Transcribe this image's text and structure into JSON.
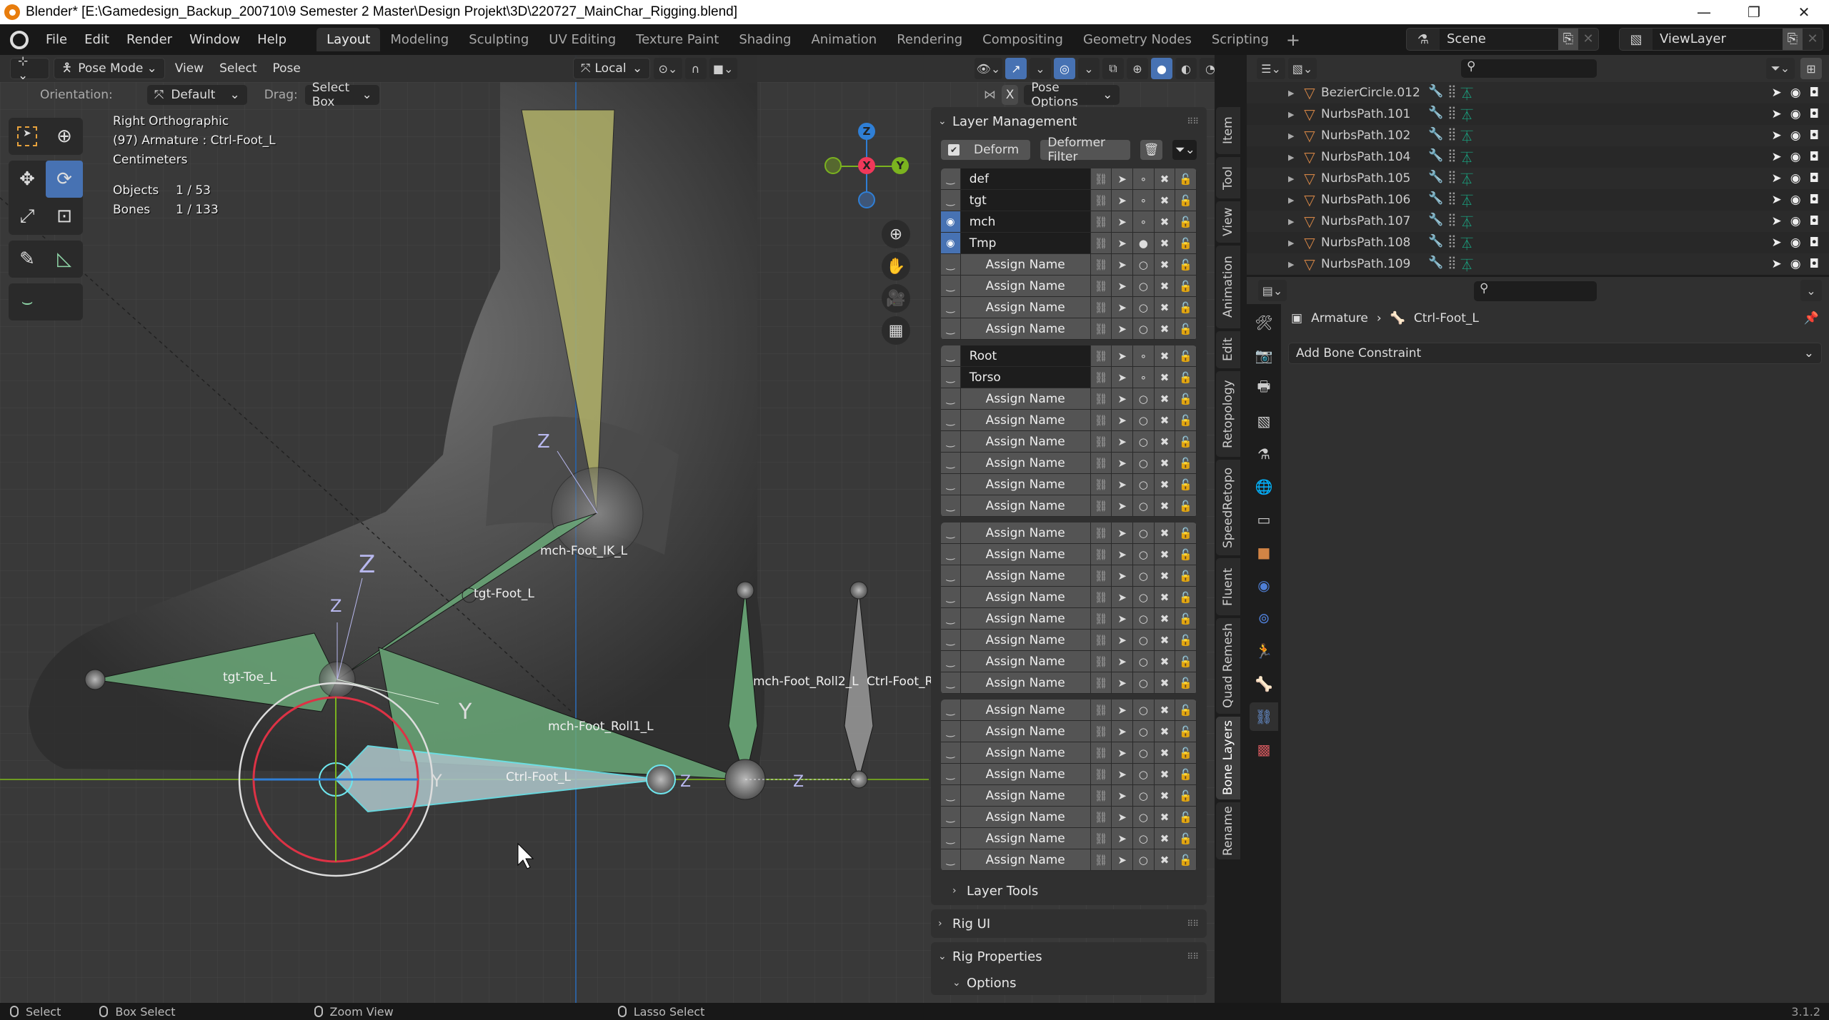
{
  "titlebar": {
    "title": "Blender* [E:\\Gamedesign_Backup_200710\\9 Semester 2 Master\\Design Projekt\\3D\\220727_MainChar_Rigging.blend]",
    "minimize": "—",
    "maximize": "❐",
    "close": "✕"
  },
  "menubar": {
    "menus": [
      "File",
      "Edit",
      "Render",
      "Window",
      "Help"
    ],
    "workspaces": [
      {
        "label": "Layout",
        "active": true
      },
      {
        "label": "Modeling"
      },
      {
        "label": "Sculpting"
      },
      {
        "label": "UV Editing"
      },
      {
        "label": "Texture Paint"
      },
      {
        "label": "Shading"
      },
      {
        "label": "Animation"
      },
      {
        "label": "Rendering"
      },
      {
        "label": "Compositing"
      },
      {
        "label": "Geometry Nodes"
      },
      {
        "label": "Scripting"
      }
    ],
    "add_workspace": "+",
    "scene": "Scene",
    "view_layer": "ViewLayer"
  },
  "viewport_header": {
    "mode": "Pose Mode",
    "menus": [
      "View",
      "Select",
      "Pose"
    ],
    "transform_orientation": "Local"
  },
  "tool_settings": {
    "orientation_label": "Orientation:",
    "orientation_value": "Default",
    "drag_label": "Drag:",
    "drag_value": "Select Box",
    "mirror_x": "X",
    "pose_options": "Pose Options"
  },
  "viewport_info": {
    "view": "Right Orthographic",
    "object": "(97) Armature : Ctrl-Foot_L",
    "units": "Centimeters",
    "objects_label": "Objects",
    "objects_value": "1 / 53",
    "bones_label": "Bones",
    "bones_value": "1 / 133"
  },
  "gizmo": {
    "z": "Z",
    "x": "X",
    "y": "Y"
  },
  "bone_labels": [
    "mch-Foot_IK_L",
    "tgt-Foot_L",
    "tgt-Toe_L",
    "mch-Foot_Roll1_L",
    "mch-Foot_Roll2_L",
    "Ctrl-Foot_Roll",
    "Ctrl-Foot_L"
  ],
  "axis_labels": {
    "z": "Z",
    "y": "Y"
  },
  "layer_management": {
    "title": "Layer Management",
    "deform_label": "Deform",
    "deform_checked": true,
    "deformer_filter": "Deformer Filter",
    "groups": [
      [
        {
          "name": "def",
          "visible": false,
          "named": true,
          "active": false
        },
        {
          "name": "tgt",
          "visible": false,
          "named": true,
          "active": false
        },
        {
          "name": "mch",
          "visible": true,
          "named": true,
          "active": false
        },
        {
          "name": "Tmp",
          "visible": true,
          "named": true,
          "active": true
        },
        {
          "name": "Assign Name",
          "visible": false,
          "named": false
        },
        {
          "name": "Assign Name",
          "visible": false,
          "named": false
        },
        {
          "name": "Assign Name",
          "visible": false,
          "named": false
        },
        {
          "name": "Assign Name",
          "visible": false,
          "named": false
        }
      ],
      [
        {
          "name": "Root",
          "visible": false,
          "named": true,
          "active": false
        },
        {
          "name": "Torso",
          "visible": false,
          "named": true,
          "active": false
        },
        {
          "name": "Assign Name",
          "visible": false,
          "named": false
        },
        {
          "name": "Assign Name",
          "visible": false,
          "named": false
        },
        {
          "name": "Assign Name",
          "visible": false,
          "named": false
        },
        {
          "name": "Assign Name",
          "visible": false,
          "named": false
        },
        {
          "name": "Assign Name",
          "visible": false,
          "named": false
        },
        {
          "name": "Assign Name",
          "visible": false,
          "named": false
        }
      ],
      [
        {
          "name": "Assign Name",
          "visible": false,
          "named": false
        },
        {
          "name": "Assign Name",
          "visible": false,
          "named": false
        },
        {
          "name": "Assign Name",
          "visible": false,
          "named": false
        },
        {
          "name": "Assign Name",
          "visible": false,
          "named": false
        },
        {
          "name": "Assign Name",
          "visible": false,
          "named": false
        },
        {
          "name": "Assign Name",
          "visible": false,
          "named": false
        },
        {
          "name": "Assign Name",
          "visible": false,
          "named": false
        },
        {
          "name": "Assign Name",
          "visible": false,
          "named": false
        }
      ],
      [
        {
          "name": "Assign Name",
          "visible": false,
          "named": false
        },
        {
          "name": "Assign Name",
          "visible": false,
          "named": false
        },
        {
          "name": "Assign Name",
          "visible": false,
          "named": false
        },
        {
          "name": "Assign Name",
          "visible": false,
          "named": false
        },
        {
          "name": "Assign Name",
          "visible": false,
          "named": false
        },
        {
          "name": "Assign Name",
          "visible": false,
          "named": false
        },
        {
          "name": "Assign Name",
          "visible": false,
          "named": false
        },
        {
          "name": "Assign Name",
          "visible": false,
          "named": false
        }
      ]
    ],
    "layer_tools": "Layer Tools"
  },
  "rig_ui": "Rig UI",
  "rig_properties": {
    "title": "Rig Properties",
    "options": "Options"
  },
  "side_tabs": [
    "Item",
    "Tool",
    "View",
    "Animation",
    "Edit",
    "Retopology",
    "SpeedRetopo",
    "Fluent",
    "Quad Remesh",
    "Bone Layers",
    "Rename"
  ],
  "active_side_tab": "Bone Layers",
  "outliner": {
    "items": [
      "BezierCircle.012",
      "NurbsPath.101",
      "NurbsPath.102",
      "NurbsPath.104",
      "NurbsPath.105",
      "NurbsPath.106",
      "NurbsPath.107",
      "NurbsPath.108",
      "NurbsPath.109"
    ]
  },
  "properties": {
    "breadcrumb_object": "Armature",
    "breadcrumb_bone": "Ctrl-Foot_L",
    "add_constraint": "Add Bone Constraint"
  },
  "statusbar": {
    "select": "Select",
    "box_select": "Box Select",
    "zoom_view": "Zoom View",
    "lasso_select": "Lasso Select",
    "version": "3.1.2"
  },
  "colors": {
    "accent": "#4772b3",
    "bone_green": "#6aa878",
    "active_bone": "#a8c0c4",
    "object_orange": "#d28445",
    "x_axis": "#f0385a",
    "y_axis": "#7bb31f",
    "z_axis": "#2f7fd6"
  }
}
